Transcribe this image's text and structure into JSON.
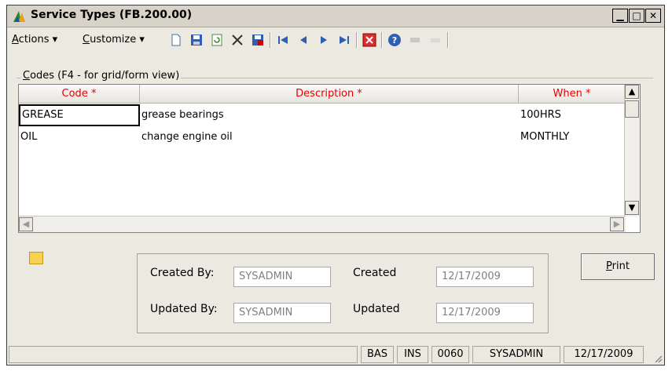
{
  "window": {
    "title": "Service Types (FB.200.00)"
  },
  "toolbar": {
    "actions_prefix": "",
    "actions_hotkey": "A",
    "actions_rest": "ctions",
    "customize_hotkey": "C",
    "customize_rest": "ustomize",
    "tools": [
      "new-icon",
      "save-icon",
      "refresh-icon",
      "delete-icon",
      "save-close-icon",
      "first-icon",
      "previous-icon",
      "next-icon",
      "last-icon",
      "close-icon",
      "help-icon",
      "disabled-icon-1",
      "disabled-icon-2"
    ]
  },
  "codes_group": {
    "label_hotkey": "C",
    "label_rest": "odes (F4 - for grid/form view)"
  },
  "grid": {
    "columns": [
      "Code *",
      "Description *",
      "When *"
    ],
    "rows": [
      {
        "code": "GREASE",
        "description": "grease bearings",
        "when": "100HRS"
      },
      {
        "code": "OIL",
        "description": "change engine oil",
        "when": "MONTHLY"
      }
    ]
  },
  "info": {
    "created_by_label": "Created By:",
    "created_by_value": "SYSADMIN",
    "created_label": "Created",
    "created_value": "12/17/2009",
    "updated_by_label": "Updated By:",
    "updated_by_value": "SYSADMIN",
    "updated_label": "Updated",
    "updated_value": "12/17/2009"
  },
  "print_button": {
    "hotkey": "P",
    "rest": "rint"
  },
  "statusbar": {
    "company": "BAS",
    "mode": "INS",
    "code": "0060",
    "user": "SYSADMIN",
    "date": "12/17/2009"
  },
  "colors": {
    "required_header": "#e60000",
    "window_bg": "#ece9e0"
  }
}
